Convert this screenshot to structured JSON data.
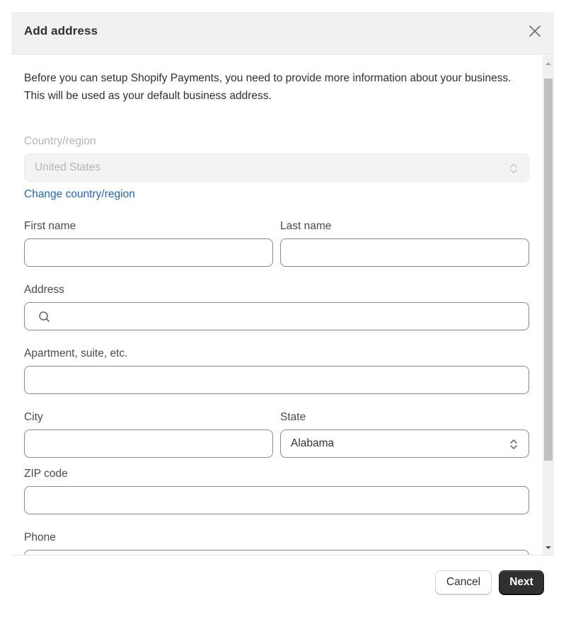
{
  "dialog": {
    "title": "Add address",
    "close_icon": "close-icon",
    "intro": "Before you can setup Shopify Payments, you need to provide more information about your business. This will be used as your default business address."
  },
  "form": {
    "country": {
      "label": "Country/region",
      "value": "United States",
      "disabled": true,
      "icon": "select-updown-icon"
    },
    "change_country_link": "Change country/region",
    "first_name": {
      "label": "First name",
      "value": "",
      "placeholder": ""
    },
    "last_name": {
      "label": "Last name",
      "value": "",
      "placeholder": ""
    },
    "address": {
      "label": "Address",
      "value": "",
      "placeholder": "",
      "icon": "search-icon"
    },
    "apartment": {
      "label": "Apartment, suite, etc.",
      "value": "",
      "placeholder": ""
    },
    "city": {
      "label": "City",
      "value": "",
      "placeholder": ""
    },
    "state": {
      "label": "State",
      "value": "Alabama",
      "icon": "select-updown-icon"
    },
    "zip": {
      "label": "ZIP code",
      "value": "",
      "placeholder": ""
    },
    "phone": {
      "label": "Phone",
      "value": "",
      "placeholder": ""
    }
  },
  "scrollbar": {
    "position_fraction": 0.02,
    "visible_fraction": 0.81
  },
  "footer": {
    "cancel_label": "Cancel",
    "next_label": "Next"
  },
  "colors": {
    "link": "#2463bc",
    "primary_button": "#303030",
    "header_bg": "#f1f1f1"
  }
}
